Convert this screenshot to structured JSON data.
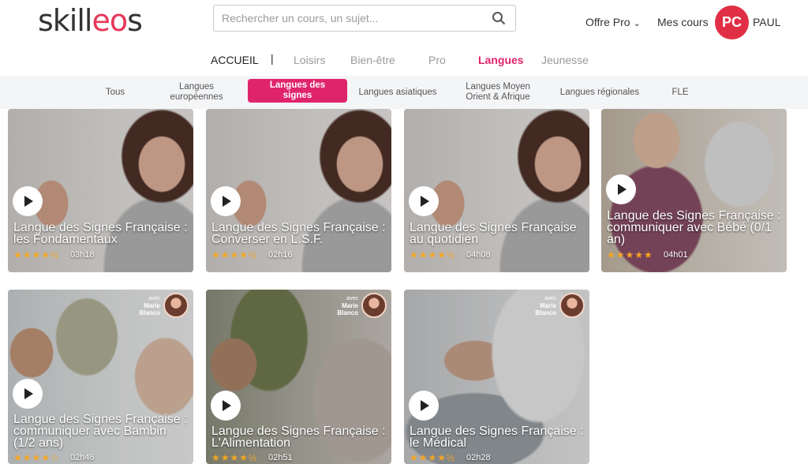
{
  "header": {
    "logo": "skilleos",
    "search_placeholder": "Rechercher un cours, un sujet...",
    "offre_pro": "Offre Pro",
    "mes_cours": "Mes cours",
    "avatar_initials": "PC",
    "username": "PAUL"
  },
  "main_nav": {
    "home": "ACCUEIL",
    "separator": "|",
    "items": [
      "Loisirs",
      "Bien-être",
      "Pro",
      "Langues",
      "Jeunesse"
    ],
    "active": "Langues"
  },
  "sub_nav": {
    "items": [
      "Tous",
      "Langues européennes",
      "Langues des signes",
      "Langues asiatiques",
      "Langues Moyen Orient & Afrique",
      "Langues régionales",
      "FLE"
    ],
    "active": "Langues des signes"
  },
  "colors": {
    "accent": "#e0246b",
    "avatar": "#e02f45",
    "star": "#f5a623"
  },
  "teacher": {
    "prefix": "avec",
    "first": "Marie",
    "last": "Blanco"
  },
  "courses": [
    {
      "title": "Langue des Signes Française : les Fondamentaux",
      "stars": "★★★★½",
      "rating": 4.5,
      "duration": "03h18"
    },
    {
      "title": "Langue des Signes Française : Converser en L.S.F.",
      "stars": "★★★★½",
      "rating": 4.5,
      "duration": "02h16"
    },
    {
      "title": "Langue des Signes Française au quotidien",
      "stars": "★★★★½",
      "rating": 4.5,
      "duration": "04h08"
    },
    {
      "title": "Langue des Signes Française : communiquer avec Bébé (0/1 an)",
      "stars": "★★★★★",
      "rating": 5,
      "duration": "04h01"
    },
    {
      "title": "Langue des Signes Française : communiquer avec Bambin (1/2 ans)",
      "stars": "★★★★☆",
      "rating": 4,
      "duration": "02h46"
    },
    {
      "title": "Langue des Signes Française : L'Alimentation",
      "stars": "★★★★½",
      "rating": 4.5,
      "duration": "02h51"
    },
    {
      "title": "Langue des Signes Française : le Médical",
      "stars": "★★★★½",
      "rating": 4.5,
      "duration": "02h28"
    }
  ]
}
